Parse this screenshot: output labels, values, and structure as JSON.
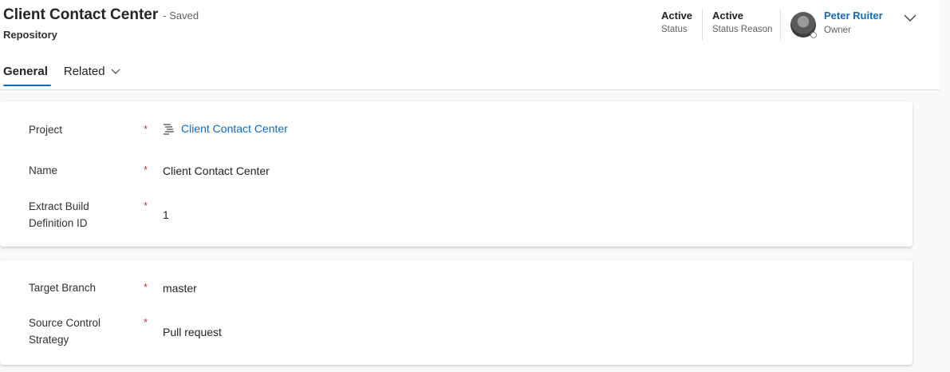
{
  "header": {
    "title": "Client Contact Center",
    "save_status": "- Saved",
    "entity": "Repository",
    "status": {
      "value": "Active",
      "label": "Status"
    },
    "status_reason": {
      "value": "Active",
      "label": "Status Reason"
    },
    "owner": {
      "name": "Peter Ruiter",
      "label": "Owner"
    }
  },
  "tabs": [
    {
      "label": "General",
      "selected": true
    },
    {
      "label": "Related",
      "selected": false
    }
  ],
  "form": {
    "section1": {
      "project": {
        "label": "Project",
        "required": "*",
        "value": "Client Contact Center",
        "icon": "project-lookup-icon"
      },
      "name": {
        "label": "Name",
        "required": "*",
        "value": "Client Contact Center"
      },
      "extract_build": {
        "label_line1": "Extract Build",
        "label_line2": "Definition ID",
        "required": "*",
        "value": "1"
      }
    },
    "section2": {
      "target_branch": {
        "label": "Target Branch",
        "required": "*",
        "value": "master"
      },
      "source_control": {
        "label_line1": "Source Control",
        "label_line2": "Strategy",
        "required": "*",
        "value": "Pull request"
      }
    }
  },
  "colors": {
    "accent": "#0f6cbd",
    "required": "#c4314b",
    "background": "#faf9f8"
  }
}
